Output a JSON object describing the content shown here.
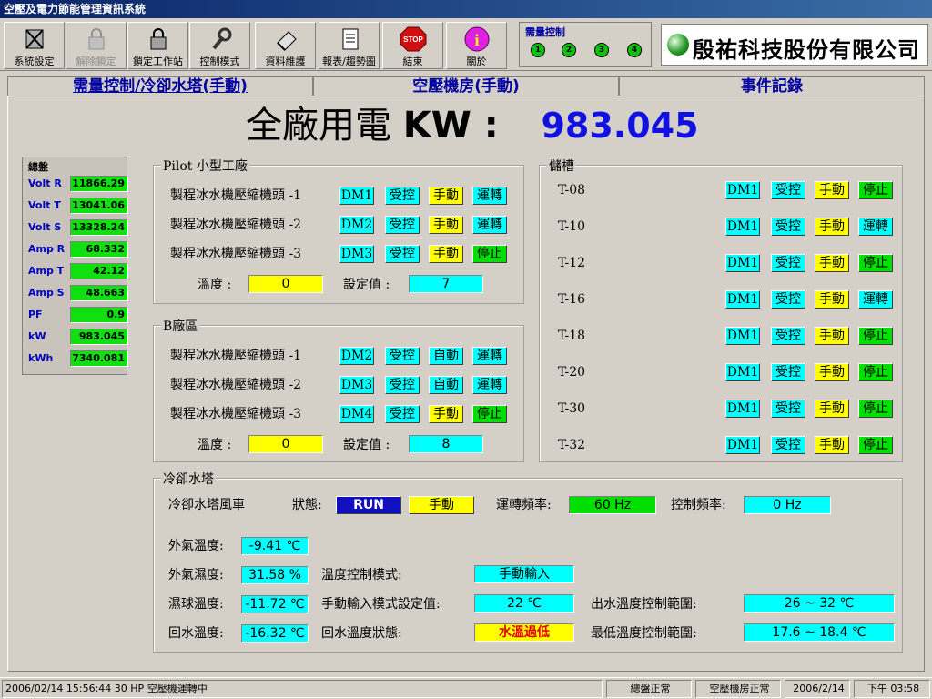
{
  "window": {
    "title": "空壓及電力節能管理資訊系統"
  },
  "toolbar": {
    "buttons": [
      {
        "label": "系統設定",
        "icon": "tools-icon"
      },
      {
        "label": "解除鎖定",
        "icon": "lock-icon",
        "disabled": true
      },
      {
        "label": "鎖定工作站",
        "icon": "lock-icon"
      },
      {
        "label": "控制模式",
        "icon": "wrench-icon"
      },
      {
        "label": "資料維護",
        "icon": "eraser-icon"
      },
      {
        "label": "報表/趨勢圖",
        "icon": "report-icon"
      },
      {
        "label": "結束",
        "icon": "stop-icon",
        "sign": "STOP"
      },
      {
        "label": "關於",
        "icon": "info-icon",
        "sign": "i"
      }
    ],
    "demand": {
      "title": "需量控制",
      "leds": [
        "1",
        "2",
        "3",
        "4"
      ]
    },
    "company": "殷祐科技股份有限公司"
  },
  "tabs": [
    "需量控制/冷卻水塔(手動)",
    "空壓機房(手動)",
    "事件記錄"
  ],
  "headline": {
    "label": "全廠用電",
    "unit": "KW :",
    "value": "983.045"
  },
  "meters": {
    "title": "總盤",
    "rows": [
      {
        "k": "Volt R",
        "v": "11866.29"
      },
      {
        "k": "Volt T",
        "v": "13041.06"
      },
      {
        "k": "Volt S",
        "v": "13328.24"
      },
      {
        "k": "Amp R",
        "v": "68.332"
      },
      {
        "k": "Amp T",
        "v": "42.12"
      },
      {
        "k": "Amp S",
        "v": "48.663"
      },
      {
        "k": "PF",
        "v": "0.9"
      },
      {
        "k": "kW",
        "v": "983.045"
      },
      {
        "k": "kWh",
        "v": "7340.081"
      }
    ]
  },
  "pilot": {
    "title": "Pilot 小型工廠",
    "rows": [
      {
        "name": "製程冰水機壓縮機頭 -1",
        "dm": "DM1",
        "ctl": "受控",
        "mode": "手動",
        "state": "運轉",
        "mode_c": "yel",
        "state_c": "cyan"
      },
      {
        "name": "製程冰水機壓縮機頭 -2",
        "dm": "DM2",
        "ctl": "受控",
        "mode": "手動",
        "state": "運轉",
        "mode_c": "yel",
        "state_c": "cyan"
      },
      {
        "name": "製程冰水機壓縮機頭 -3",
        "dm": "DM3",
        "ctl": "受控",
        "mode": "手動",
        "state": "停止",
        "mode_c": "yel",
        "state_c": "grn"
      }
    ],
    "temp_label": "溫度 :",
    "temp": "0",
    "set_label": "設定值 :",
    "set": "7"
  },
  "bzone": {
    "title": "B廠區",
    "rows": [
      {
        "name": "製程冰水機壓縮機頭 -1",
        "dm": "DM2",
        "ctl": "受控",
        "mode": "自動",
        "state": "運轉",
        "mode_c": "cyan",
        "state_c": "cyan"
      },
      {
        "name": "製程冰水機壓縮機頭 -2",
        "dm": "DM3",
        "ctl": "受控",
        "mode": "自動",
        "state": "運轉",
        "mode_c": "cyan",
        "state_c": "cyan"
      },
      {
        "name": "製程冰水機壓縮機頭 -3",
        "dm": "DM4",
        "ctl": "受控",
        "mode": "手動",
        "state": "停止",
        "mode_c": "yel",
        "state_c": "grn"
      }
    ],
    "temp_label": "溫度 :",
    "temp": "0",
    "set_label": "設定值 :",
    "set": "8"
  },
  "tanks": {
    "title": "儲槽",
    "rows": [
      {
        "name": "T-08",
        "dm": "DM1",
        "ctl": "受控",
        "mode": "手動",
        "state": "停止",
        "state_c": "grn"
      },
      {
        "name": "T-10",
        "dm": "DM1",
        "ctl": "受控",
        "mode": "手動",
        "state": "運轉",
        "state_c": "cyan"
      },
      {
        "name": "T-12",
        "dm": "DM1",
        "ctl": "受控",
        "mode": "手動",
        "state": "停止",
        "state_c": "grn"
      },
      {
        "name": "T-16",
        "dm": "DM1",
        "ctl": "受控",
        "mode": "手動",
        "state": "運轉",
        "state_c": "cyan"
      },
      {
        "name": "T-18",
        "dm": "DM1",
        "ctl": "受控",
        "mode": "手動",
        "state": "停止",
        "state_c": "grn"
      },
      {
        "name": "T-20",
        "dm": "DM1",
        "ctl": "受控",
        "mode": "手動",
        "state": "停止",
        "state_c": "grn"
      },
      {
        "name": "T-30",
        "dm": "DM1",
        "ctl": "受控",
        "mode": "手動",
        "state": "停止",
        "state_c": "grn"
      },
      {
        "name": "T-32",
        "dm": "DM1",
        "ctl": "受控",
        "mode": "手動",
        "state": "停止",
        "state_c": "grn"
      }
    ]
  },
  "tower": {
    "title": "冷卻水塔",
    "fan": "冷卻水塔風車",
    "status_label": "狀態:",
    "status": "RUN",
    "mode": "手動",
    "freq_label": "運轉頻率:",
    "freq": "60 Hz",
    "ctrl_freq_label": "控制頻率:",
    "ctrl_freq": "0 Hz",
    "outtemp_label": "外氣溫度:",
    "outtemp": "-9.41 ℃",
    "humid_label": "外氣濕度:",
    "humid": "31.58 %",
    "wetbulb_label": "濕球溫度:",
    "wetbulb": "-11.72 ℃",
    "return_label": "回水溫度:",
    "return": "-16.32 ℃",
    "tcmode_label": "溫度控制模式:",
    "tcmode": "手動輸入",
    "manual_label": "手動輸入模式設定值:",
    "manual": "22 ℃",
    "rstate_label": "回水溫度狀態:",
    "rstate": "水溫過低",
    "outrange_label": "出水溫度控制範圍:",
    "outrange": "26 ~ 32 ℃",
    "minrange_label": "最低溫度控制範圍:",
    "minrange": "17.6 ~ 18.4 ℃"
  },
  "statusbar": {
    "event": "2006/02/14 15:56:44 30 HP 空壓機運轉中",
    "main": "總盤正常",
    "room": "空壓機房正常",
    "date": "2006/2/14",
    "time": "下午 03:58"
  }
}
